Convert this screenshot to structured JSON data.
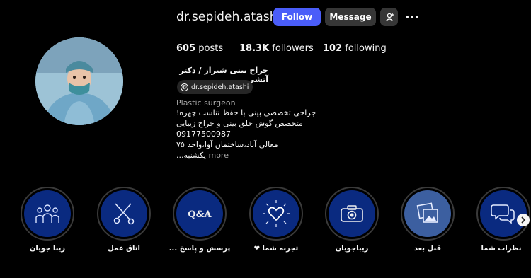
{
  "profile": {
    "username": "dr.sepideh.atashi",
    "follow_label": "Follow",
    "message_label": "Message",
    "stats": {
      "posts_count": "605",
      "posts_label": "posts",
      "followers_count": "18.3K",
      "followers_label": "followers",
      "following_count": "102",
      "following_label": "following"
    },
    "full_name": "جراح بینی شیراز / دکتر آتشی",
    "threads_handle": "dr.sepideh.atashi",
    "category": "Plastic surgeon",
    "bio_lines": [
      "جراحی تخصصی بینی با حفظ تناسب چهره!",
      "متخصص گوش حلق بینی و جراح زیبایی",
      "09177500987",
      "معالی آباد،ساختمان آوا،واحد ۷۵",
      "یکشنبه..."
    ],
    "more_label": "more"
  },
  "highlights": [
    {
      "label": "زیبا جویان",
      "icon": "group-icon",
      "color": "#0a2a80"
    },
    {
      "label": "اتاق عمل",
      "icon": "surgical-tools-icon",
      "color": "#0a2a80"
    },
    {
      "label": "پرسش و پاسخ ...",
      "icon": "qa-icon",
      "color": "#0a2a80"
    },
    {
      "label": "تجربه شما ❤",
      "icon": "heart-icon",
      "color": "#0a2a80"
    },
    {
      "label": "زیباجویان",
      "icon": "camera-icon",
      "color": "#0a2a80"
    },
    {
      "label": "قبل بعد",
      "icon": "photos-icon",
      "color": "#3c5fa0"
    },
    {
      "label": "نظرات شما",
      "icon": "chat-bubbles-icon",
      "color": "#0a2a80"
    }
  ],
  "colors": {
    "background": "#000000",
    "follow_button": "#4a5df9",
    "secondary_button": "#363636",
    "highlight_fill": "#0a2a80"
  }
}
